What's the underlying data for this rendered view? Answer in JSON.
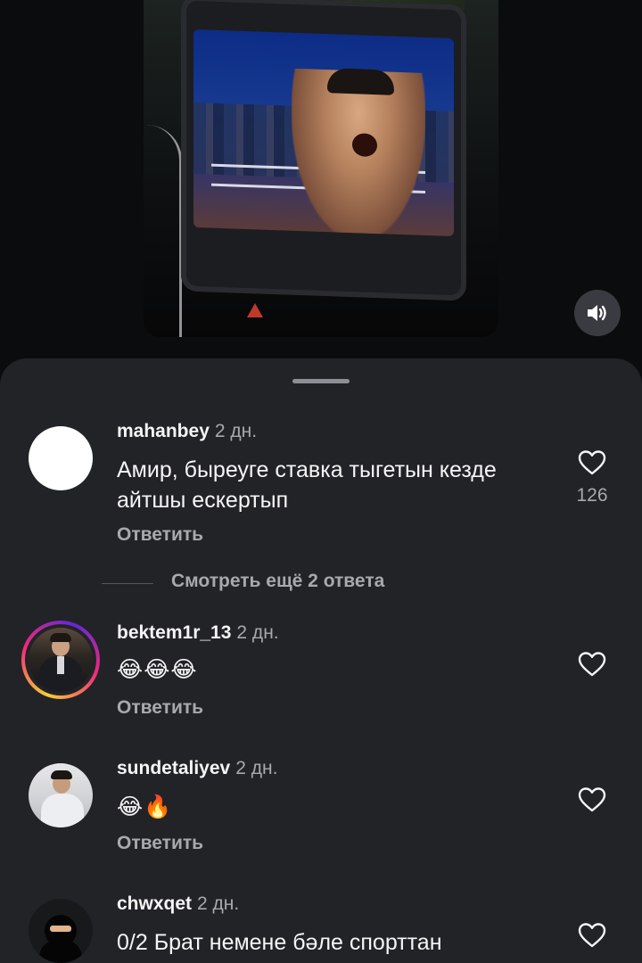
{
  "comments": [
    {
      "username": "mahanbey",
      "time": "2 дн.",
      "text": "Амир, быреуге ставка тыгетын кезде айтшы ескертып",
      "reply_label": "Ответить",
      "likes": "126"
    },
    {
      "username": "bektem1r_13",
      "time": "2 дн.",
      "text": "😂😂😂",
      "reply_label": "Ответить",
      "likes": ""
    },
    {
      "username": "sundetaliyev",
      "time": "2 дн.",
      "text": "😂🔥",
      "reply_label": "Ответить",
      "likes": ""
    },
    {
      "username": "chwxqet",
      "time": "2 дн.",
      "text": "0/2 Брат немене бәле спорттан",
      "reply_label": "",
      "likes": ""
    }
  ],
  "view_more_replies": "Смотреть ещё 2 ответа",
  "icons": {
    "sound": "speaker-icon",
    "like": "heart-outline-icon"
  },
  "colors": {
    "sheet_background": "#222327",
    "page_background": "#0b0c0e",
    "secondary_text": "#a8a9ad"
  }
}
